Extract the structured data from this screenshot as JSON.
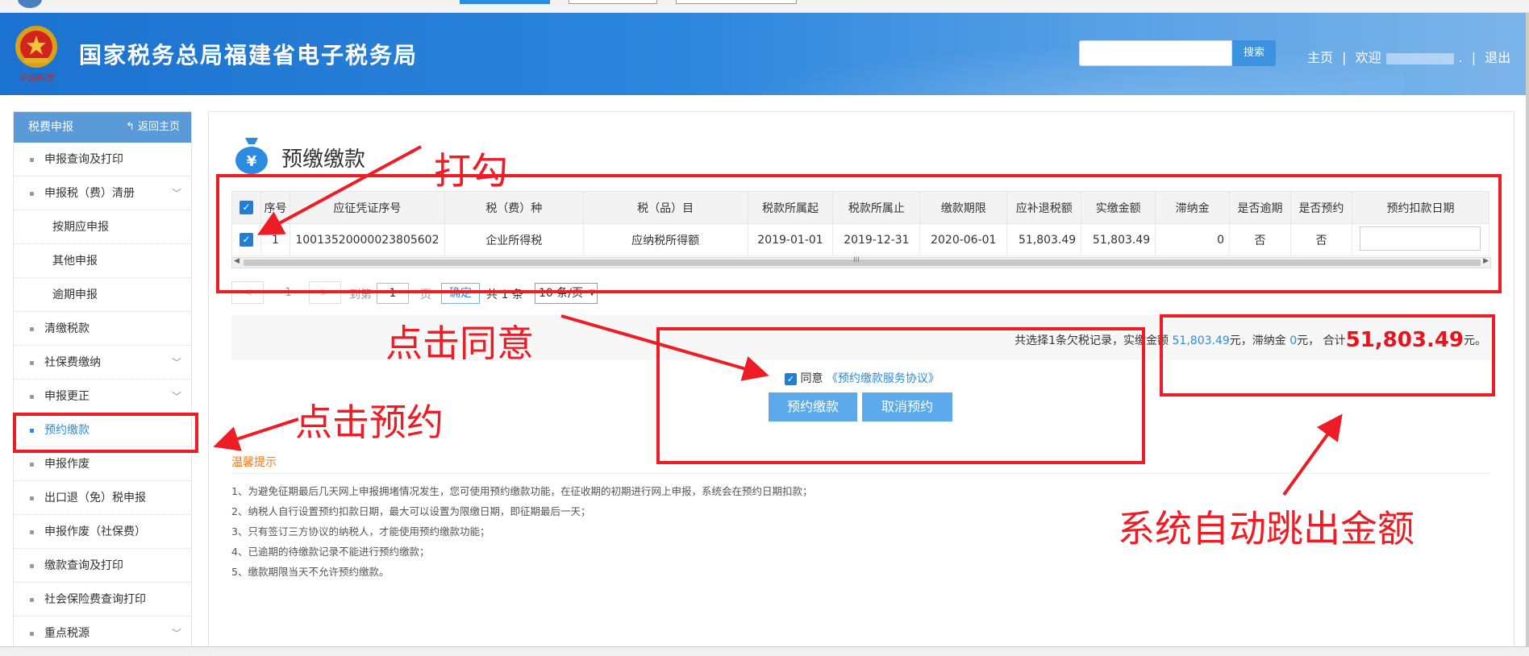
{
  "header": {
    "site_title": "国家税务总局福建省电子税务局",
    "emblem_caption": "中国税务",
    "search_placeholder": "",
    "search_button": "搜索",
    "home_link": "主页",
    "sep1": "|",
    "welcome": "欢迎",
    "dot": ".",
    "sep2": "|",
    "logout": "退出"
  },
  "sidebar": {
    "title": "税费申报",
    "back": "返回主页",
    "items": [
      {
        "label": "申报查询及打印"
      },
      {
        "label": "申报税（费）清册"
      },
      {
        "label": "按期应申报"
      },
      {
        "label": "其他申报"
      },
      {
        "label": "逾期申报"
      },
      {
        "label": "清缴税款"
      },
      {
        "label": "社保费缴纳"
      },
      {
        "label": "申报更正"
      },
      {
        "label": "预约缴款"
      },
      {
        "label": "申报作废"
      },
      {
        "label": "出口退（免）税申报"
      },
      {
        "label": "申报作废（社保费）"
      },
      {
        "label": "缴款查询及打印"
      },
      {
        "label": "社会保险费查询打印"
      },
      {
        "label": "重点税源"
      }
    ]
  },
  "main": {
    "title": "预缴缴款",
    "icon_glyph": "¥",
    "table": {
      "headers": [
        "序号",
        "应征凭证序号",
        "税（费）种",
        "税（品）目",
        "税款所属起",
        "税款所属止",
        "缴款期限",
        "应补退税额",
        "实缴金额",
        "滞纳金",
        "是否逾期",
        "是否预约",
        "预约扣款日期"
      ],
      "row": {
        "check": "✓",
        "index": "1",
        "voucher": "10013520000023805602",
        "tax_type": "企业所得税",
        "tax_item": "应纳税所得额",
        "period_start": "2019-01-01",
        "period_end": "2019-12-31",
        "deadline": "2020-06-01",
        "due_amount": "51,803.49",
        "paid_amount": "51,803.49",
        "late_fee": "0",
        "overdue": "否",
        "reserved": "否"
      },
      "header_check": "✓",
      "scroll_mid": "III"
    },
    "pager": {
      "prev": "<",
      "page": "1",
      "next": ">",
      "goto": "到第",
      "page_input": "1",
      "page_unit": "页",
      "ok": "确定",
      "total": "共 1 条",
      "page_size": "10 条/页"
    },
    "summary": {
      "prefix": "共选择1条欠税记录，实缴金额",
      "paid": "51,803.49",
      "unit1": "元，滞纳金",
      "late": "0",
      "unit2": "元， 合计",
      "total": "51,803.49",
      "unit3": "元。"
    },
    "agree": {
      "check": "✓",
      "label": "同意",
      "link": "《预约缴款服务协议》"
    },
    "buttons": {
      "book": "预约缴款",
      "cancel": "取消预约"
    },
    "tips": {
      "title": "温馨提示",
      "lines": [
        "1、为避免征期最后几天网上申报拥堵情况发生，您可使用预约缴款功能，在征收期的初期进行网上申报，系统会在预约日期扣款；",
        "2、纳税人自行设置预约扣款日期，最大可以设置为限缴日期，即征期最后一天；",
        "3、只有签订三方协议的纳税人，才能使用预约缴款功能；",
        "4、已逾期的待缴款记录不能进行预约缴款；",
        "5、缴款期限当天不允许预约缴款。"
      ]
    }
  },
  "annotations": {
    "check": "打勾",
    "agree": "点击同意",
    "book": "点击预约",
    "auto": "系统自动跳出金额"
  },
  "colors": {
    "header_blue": "#1b72d0",
    "accent_blue": "#2a8be0",
    "annotation_red": "#ee1c24",
    "total_red": "#e8131b",
    "tips_orange": "#f07b1d"
  }
}
